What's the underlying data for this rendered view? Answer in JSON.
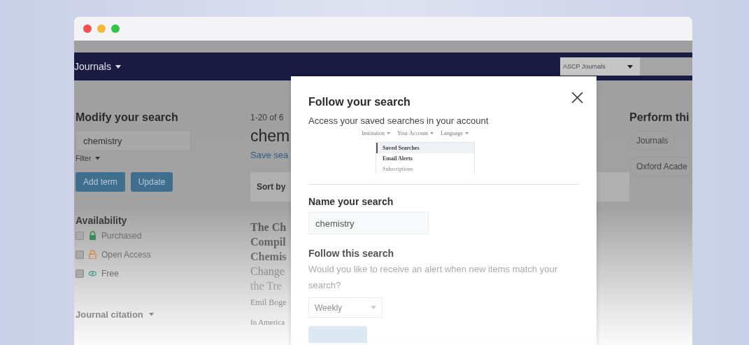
{
  "browser": {
    "traffic_lights": [
      {
        "color": "#f0524f"
      },
      {
        "color": "#f5b83c"
      },
      {
        "color": "#35c24a"
      }
    ]
  },
  "nav": {
    "menu": "Journals",
    "journal_select": "ASCP Journals"
  },
  "sidebar": {
    "title": "Modify your search",
    "search_value": "chemistry",
    "filter": "Filter",
    "buttons": [
      "Add term",
      "Update"
    ],
    "availability": {
      "title": "Availability",
      "options": [
        {
          "label": "Purchased",
          "kind": "purchased",
          "checked": false
        },
        {
          "label": "Open Access",
          "kind": "open_access",
          "checked": false
        },
        {
          "label": "Free",
          "kind": "free",
          "checked": false
        }
      ]
    },
    "journal_citation": "Journal citation"
  },
  "results": {
    "count": "1-20 of 6",
    "query": "chem",
    "save_link": "Save sea",
    "sort_label": "Sort by",
    "title_lines": [
      "The Ch",
      "Compil",
      "Chemis",
      "Change",
      "the Tre"
    ],
    "author": "Emil Boge",
    "source": "In America"
  },
  "right_panel": {
    "title": "Perform thi",
    "chips": [
      "Journals",
      "Oxford Acade"
    ]
  },
  "modal": {
    "title": "Follow your search",
    "description": "Access your saved searches in your account",
    "illustration": {
      "menu": [
        "Institution",
        "Your Account",
        "Language"
      ],
      "items": [
        {
          "label": "Saved Searches",
          "selected": true
        },
        {
          "label": "Email Alerts",
          "selected": false
        },
        {
          "label": "Subscriptions",
          "selected": false
        }
      ]
    },
    "name_label": "Name your search",
    "name_value": "chemistry",
    "follow_title": "Follow this search",
    "follow_text": "Would you like to receive an alert when new items match your search?",
    "frequency": "Weekly"
  }
}
